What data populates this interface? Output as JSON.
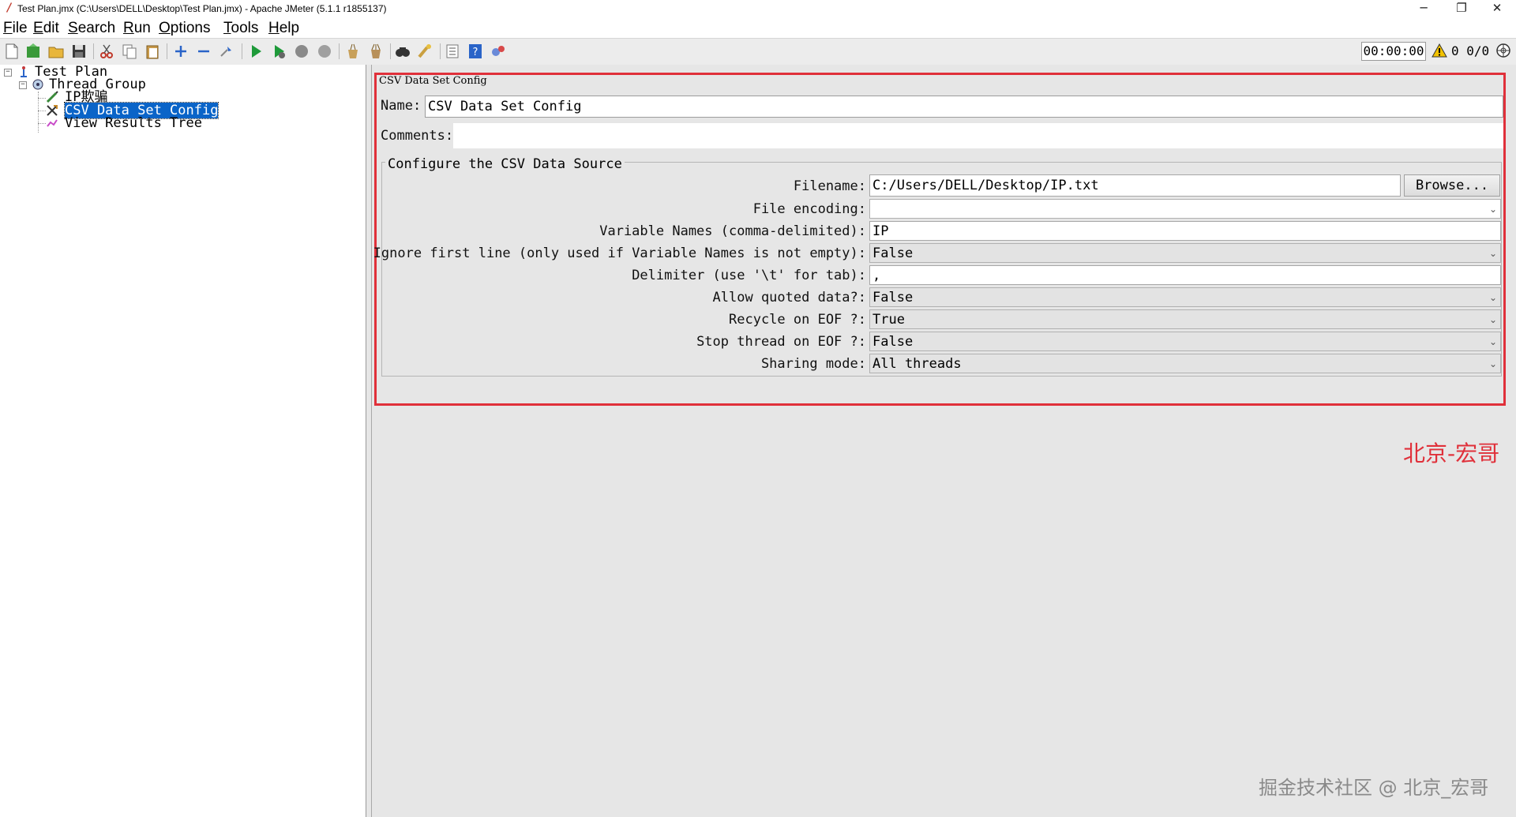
{
  "window": {
    "title": "Test Plan.jmx (C:\\Users\\DELL\\Desktop\\Test Plan.jmx) - Apache JMeter (5.1.1 r1855137)",
    "minimize_glyph": "─",
    "restore_glyph": "❐",
    "close_glyph": "✕"
  },
  "menu": {
    "file": {
      "mn": "F",
      "rest": "ile"
    },
    "edit": {
      "mn": "E",
      "rest": "dit"
    },
    "search": {
      "mn": "S",
      "rest": "earch"
    },
    "run": {
      "mn": "R",
      "rest": "un"
    },
    "options": {
      "mn": "O",
      "rest": "ptions"
    },
    "tools": {
      "mn": "T",
      "rest": "ools"
    },
    "help": {
      "mn": "H",
      "rest": "elp"
    }
  },
  "toolbar": {
    "timer": "00:00:00",
    "error_count": "0",
    "thread_count": "0/0"
  },
  "tree": {
    "test_plan": "Test Plan",
    "thread_group": "Thread Group",
    "ip_item": "IP欺骗",
    "csv_config": "CSV Data Set Config",
    "view_results": "View Results Tree"
  },
  "panel": {
    "title": "CSV Data Set Config",
    "name_label": "Name:",
    "name_value": "CSV Data Set Config",
    "comments_label": "Comments:",
    "group_title": "Configure the CSV Data Source",
    "filename_label": "Filename:",
    "filename_value": "C:/Users/DELL/Desktop/IP.txt",
    "browse_label": "Browse...",
    "encoding_label": "File encoding:",
    "encoding_value": "",
    "varnames_label": "Variable Names (comma-delimited):",
    "varnames_value": "IP",
    "ignore_label": "Ignore first line (only used if Variable Names is not empty):",
    "ignore_value": "False",
    "delimiter_label": "Delimiter (use '\\t' for tab):",
    "delimiter_value": ",",
    "quoted_label": "Allow quoted data?:",
    "quoted_value": "False",
    "recycle_label": "Recycle on EOF ?:",
    "recycle_value": "True",
    "stop_label": "Stop thread on EOF ?:",
    "stop_value": "False",
    "sharing_label": "Sharing mode:",
    "sharing_value": "All threads"
  },
  "watermarks": {
    "red": "北京-宏哥",
    "gray": "掘金技术社区 @ 北京_宏哥"
  },
  "colors": {
    "highlight_border": "#e0303a",
    "selection": "#0a64c8",
    "panel_bg": "#e6e6e6"
  }
}
